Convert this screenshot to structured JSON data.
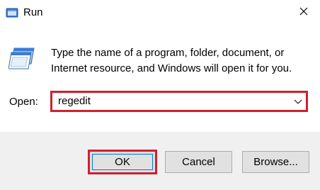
{
  "window": {
    "title": "Run",
    "close_icon": "close-icon",
    "app_icon": "run-app-icon"
  },
  "body": {
    "icon": "run-icon",
    "description_line1": "Type the name of a program, folder, document, or",
    "description_line2": "Internet resource, and Windows will open it for you.",
    "open_label": "Open:",
    "open_value": "regedit",
    "dropdown_icon": "chevron-down-icon"
  },
  "buttons": {
    "ok": "OK",
    "cancel": "Cancel",
    "browse": "Browse..."
  },
  "colors": {
    "highlight": "#d0202e",
    "footer_bg": "#f0f0f0",
    "button_bg": "#e1e1e1",
    "focus_border": "#0078d7"
  }
}
